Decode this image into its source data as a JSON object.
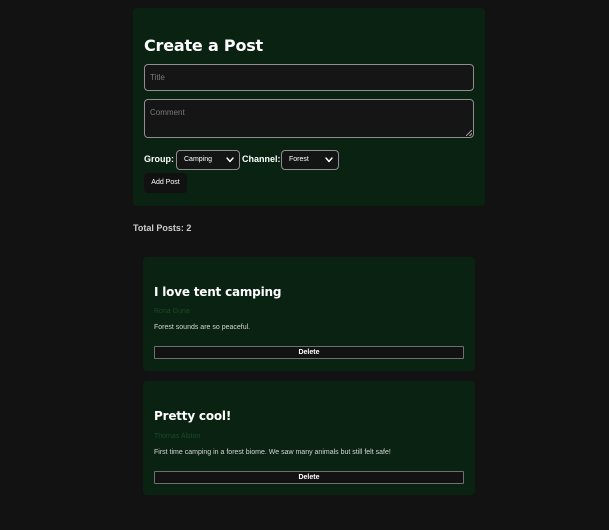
{
  "create_post": {
    "heading": "Create a Post",
    "title_placeholder": "Title",
    "title_value": "",
    "comment_placeholder": "Comment",
    "comment_value": "",
    "group_label": "Group:",
    "group_selected": "Camping",
    "channel_label": "Channel:",
    "channel_selected": "Forest",
    "add_button_label": "Add Post"
  },
  "total_posts_text": "Total Posts: 2",
  "posts": [
    {
      "title": "I love tent camping",
      "author": "Rona Guna",
      "body": "Forest sounds are so peaceful.",
      "delete_label": "Delete"
    },
    {
      "title": "Pretty cool!",
      "author": "Thomas Alston",
      "body": "First time camping in a forest biome. We saw many animals but still felt safe!",
      "delete_label": "Delete"
    }
  ],
  "colors": {
    "page_background": "#121212",
    "card_background": "#0a2212",
    "input_background": "#151515",
    "author_text": "#1c4a28"
  },
  "icons": {
    "select_arrow": "chevron-down-icon"
  }
}
